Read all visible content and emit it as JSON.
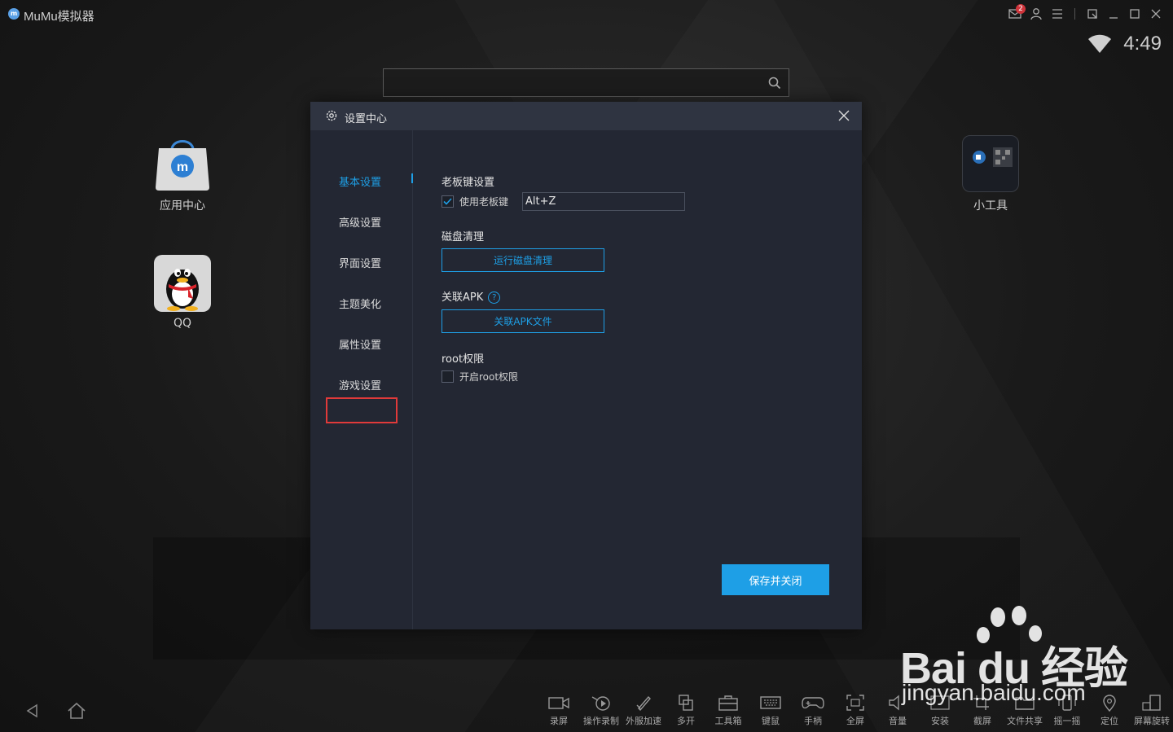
{
  "window": {
    "title": "MuMu模拟器",
    "notification_count": "2"
  },
  "status": {
    "time": "4:49"
  },
  "search": {
    "value": "",
    "placeholder": ""
  },
  "desktop": {
    "apps": [
      {
        "label": "应用中心"
      },
      {
        "label": "QQ"
      },
      {
        "label": "小工具"
      }
    ]
  },
  "dialog": {
    "title": "设置中心",
    "nav": [
      "基本设置",
      "高级设置",
      "界面设置",
      "主题美化",
      "属性设置",
      "游戏设置"
    ],
    "active_nav": "基本设置",
    "boss_key": {
      "title": "老板键设置",
      "checkbox_label": "使用老板键",
      "checked": true,
      "value": "Alt+Z"
    },
    "disk": {
      "title": "磁盘清理",
      "button": "运行磁盘清理"
    },
    "apk": {
      "title": "关联APK",
      "help": "?",
      "button": "关联APK文件"
    },
    "root": {
      "title": "root权限",
      "checkbox_label": "开启root权限",
      "checked": false
    },
    "save_button": "保存并关闭"
  },
  "toolbar": [
    "录屏",
    "操作录制",
    "外服加速",
    "多开",
    "工具箱",
    "键鼠",
    "手柄",
    "全屏",
    "音量",
    "安装",
    "截屏",
    "文件共享",
    "摇一摇",
    "定位",
    "屏幕旋转"
  ],
  "watermark": {
    "brand": "Bai du 经验",
    "url": "jingyan.baidu.com"
  },
  "colors": {
    "accent": "#1e9fe6",
    "highlight": "#e03a3a",
    "dialog_bg": "#232733"
  }
}
